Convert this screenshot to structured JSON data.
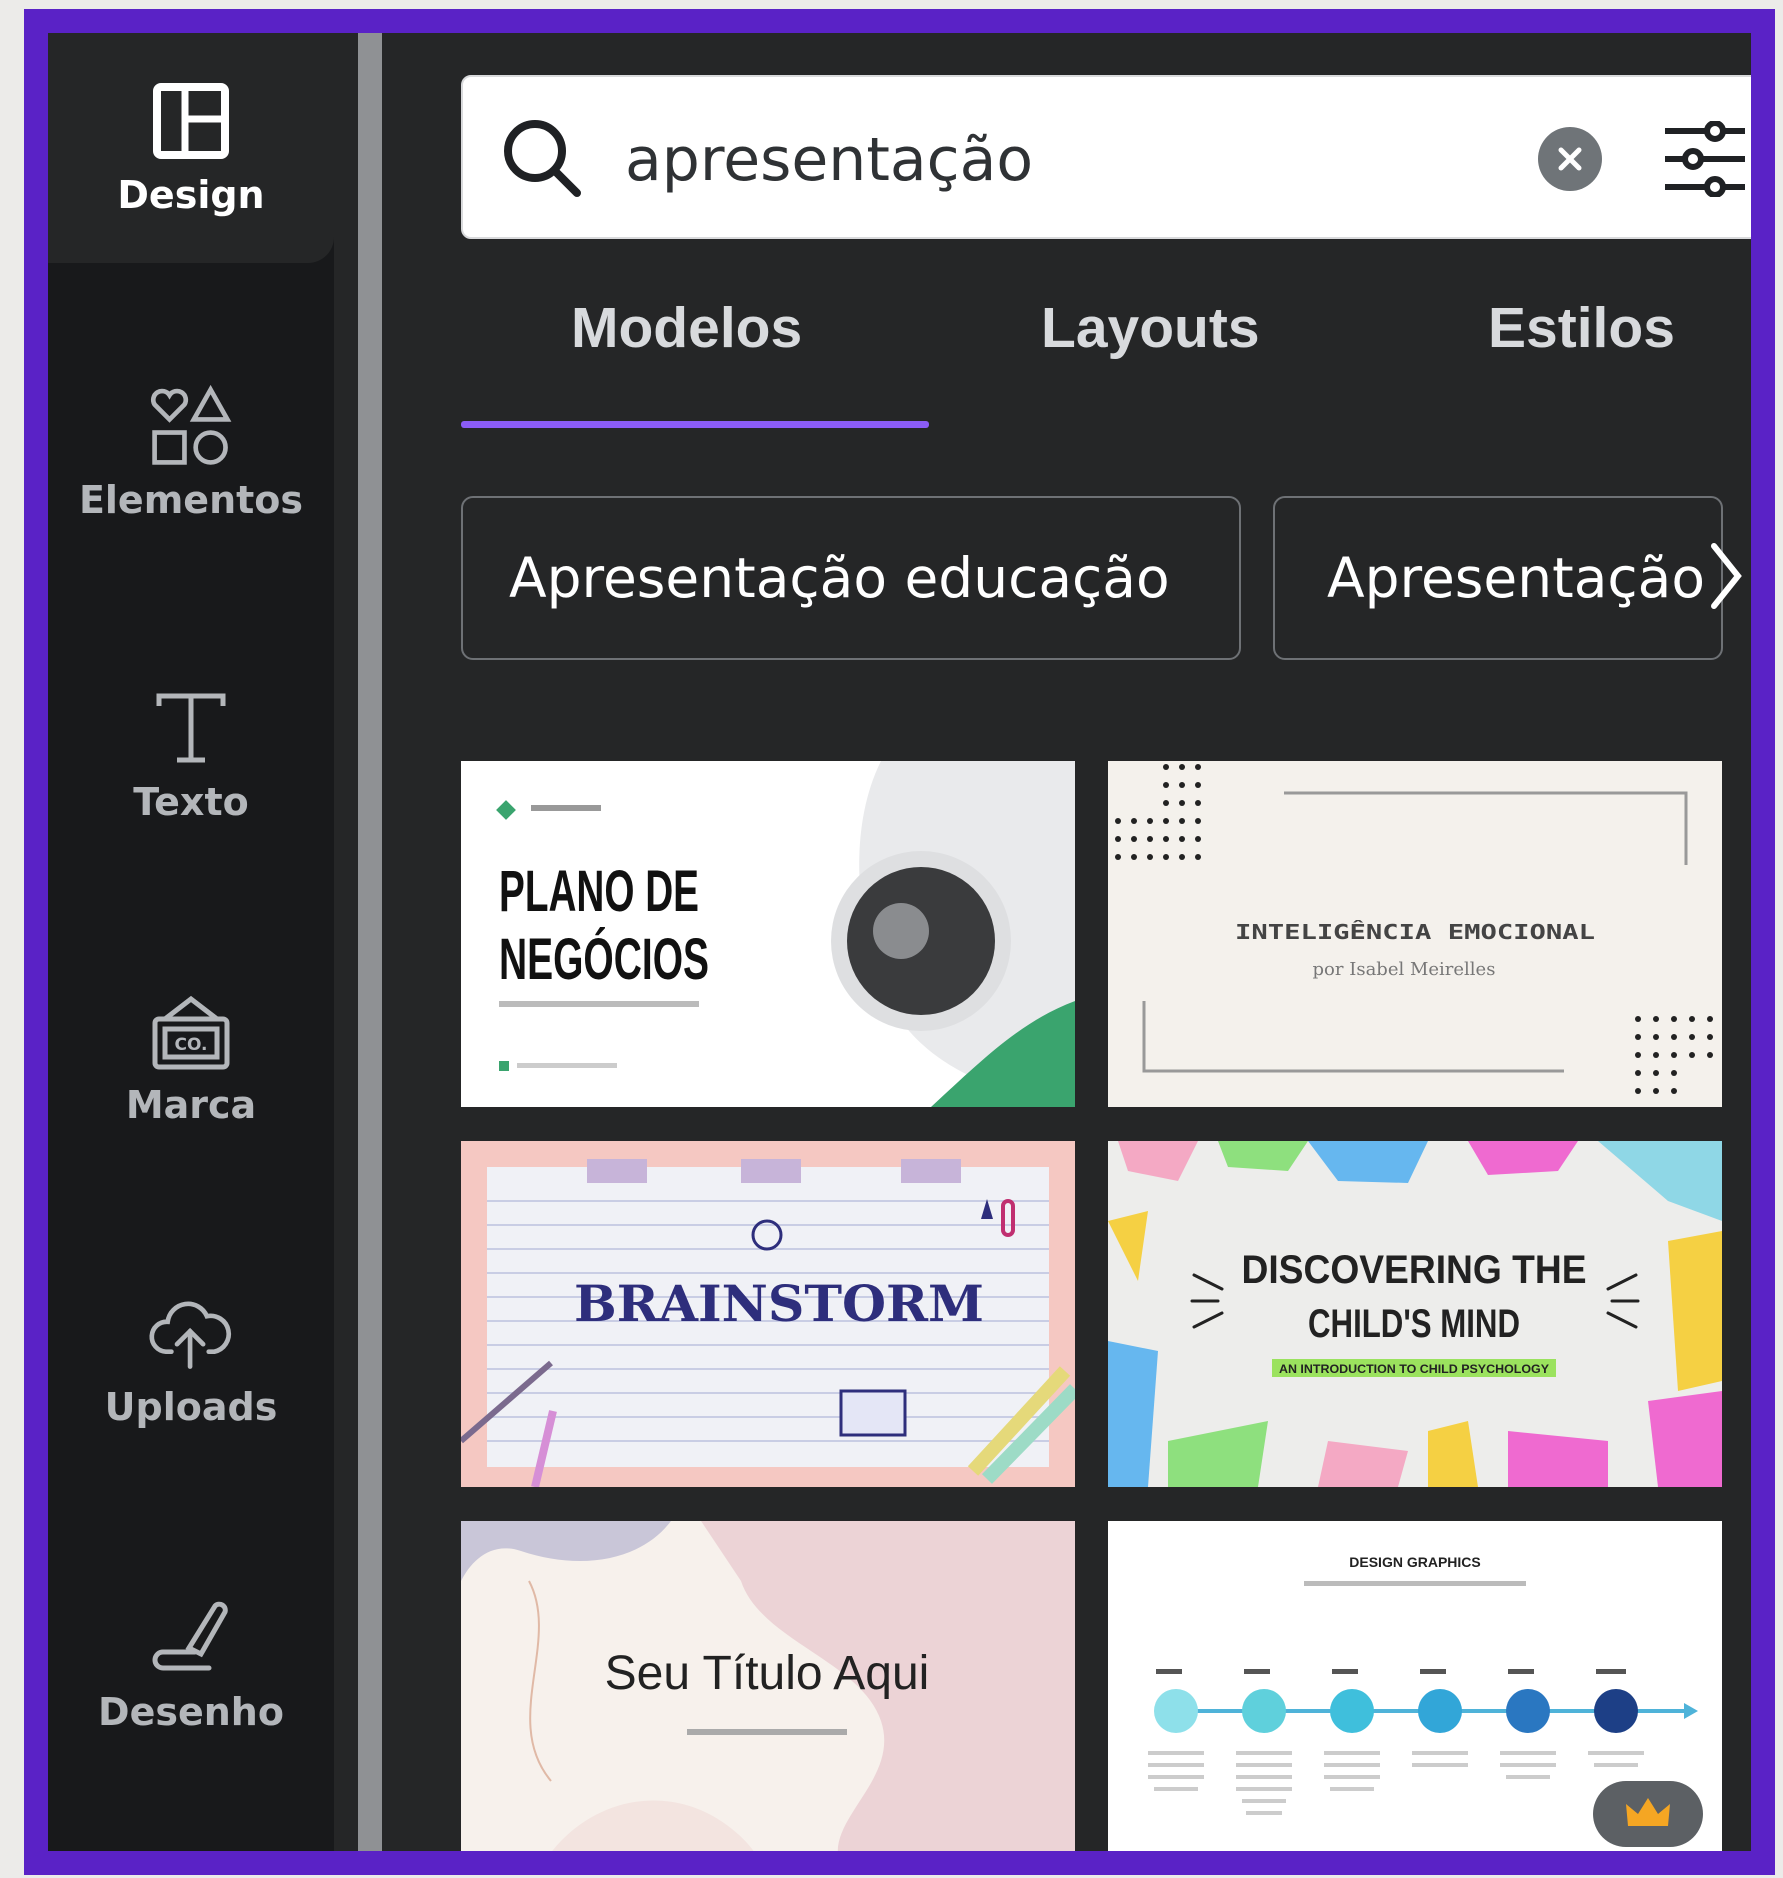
{
  "sidebar": {
    "items": [
      {
        "label": "Design",
        "icon": "layout-icon",
        "active": true
      },
      {
        "label": "Elementos",
        "icon": "shapes-icon"
      },
      {
        "label": "Texto",
        "icon": "text-icon"
      },
      {
        "label": "Marca",
        "icon": "brand-icon"
      },
      {
        "label": "Uploads",
        "icon": "cloud-upload-icon"
      },
      {
        "label": "Desenho",
        "icon": "draw-icon"
      }
    ]
  },
  "search": {
    "value": "apresentação"
  },
  "tabs": [
    {
      "label": "Modelos",
      "active": true
    },
    {
      "label": "Layouts"
    },
    {
      "label": "Estilos"
    }
  ],
  "chips": [
    {
      "label": "Apresentação educação"
    },
    {
      "label": "Apresentação"
    }
  ],
  "templates": [
    {
      "title_line1": "PLANO DE",
      "title_line2": "NEGÓCIOS"
    },
    {
      "title": "INTELIGÊNCIA EMOCIONAL",
      "subtitle": "por Isabel Meirelles"
    },
    {
      "title": "BRAINSTORM"
    },
    {
      "title_line1": "DISCOVERING THE",
      "title_line2": "CHILD'S MIND",
      "subtitle": "AN INTRODUCTION TO CHILD PSYCHOLOGY"
    },
    {
      "title": "Seu Título Aqui"
    },
    {
      "title": "DESIGN GRAPHICS",
      "premium": true
    }
  ],
  "colors": {
    "accent": "#8b5cf6",
    "frame": "#5a22c6",
    "panel": "#252627",
    "sidebar": "#18191b"
  }
}
